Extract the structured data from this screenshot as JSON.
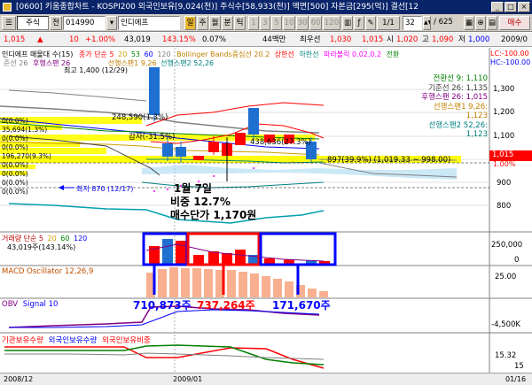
{
  "window": {
    "title": "[0600] 키움종합차트 - KOSPI200 외국인보유[9,024(천)] 주식수[58,933(천)] 액면[500] 자본금[295(억)] 결선[12"
  },
  "toolbar": {
    "market": "주식",
    "prev": "전",
    "code": "014990",
    "name": "인디에프",
    "period_day": "일",
    "period_week": "주",
    "period_month": "월",
    "period_min": "분",
    "period_tick": "틱",
    "nums": [
      "1",
      "3",
      "5",
      "10",
      "30",
      "60",
      "120"
    ],
    "ratio": "1/1",
    "count": "32",
    "total": "/ 625",
    "buy": "매수"
  },
  "quote": {
    "price": "1,015",
    "change": "▲",
    "change_val": "10",
    "change_pct": "+1.00%",
    "volume": "43,019",
    "vol_ratio": "143.15%",
    "turnover": "0.07%",
    "amount": "44백만",
    "low_label": "최우선",
    "ask": "1,030",
    "bid": "1,015",
    "open_label": "시",
    "open": "1,020",
    "high_label": "고",
    "high": "1,090",
    "low_lbl2": "저",
    "low": "1,000",
    "date": "2009/0"
  },
  "price_panel": {
    "header": [
      {
        "text": "인디에프 매물대 수(15)",
        "color": "#000000"
      },
      {
        "text": "종가 단순 5",
        "color": "#ff0000"
      },
      {
        "text": "20",
        "color": "#d0a000"
      },
      {
        "text": "53",
        "color": "#008000"
      },
      {
        "text": "60",
        "color": "#0000ff"
      },
      {
        "text": "120",
        "color": "#808080"
      },
      {
        "text": "Bollinger Bands중심선 20.2",
        "color": "#c08000"
      },
      {
        "text": "상한선",
        "color": "#ff0000"
      },
      {
        "text": "하한선",
        "color": "#008080"
      },
      {
        "text": "파라볼릭 0.02,0.2",
        "color": "#ff00ff"
      },
      {
        "text": "전환",
        "color": "#008000"
      }
    ],
    "header2": [
      {
        "text": "준선 26",
        "color": "#808080"
      },
      {
        "text": "후행스팬 26",
        "color": "#800080"
      },
      {
        "text": "선행스팬1 9,26",
        "color": "#c08000"
      },
      {
        "text": "선행스팬2 52,26",
        "color": "#008080"
      }
    ],
    "high_note": "최고 1,400 (12/29)",
    "low_note": "최저 870 (12/17)",
    "pct_note_left": "248,590(1.3%)",
    "pct_note_mid": "감자(-31.5%)",
    "pct_note_mid2": "438,636(27.3%)",
    "band_note": "897(39.9%) (1,019.33 ~ 998.00)",
    "left_pct_labels": [
      "0(0.0%)",
      "0(0.0%)",
      "0(0.0%)",
      "0(0.0%)",
      "0(0.0%)",
      "0(0.0%)",
      "0(0.0%)"
    ],
    "band_left_label": "196,270(9.3%)",
    "band_left_label2": "35,694(1.3%)",
    "legend": [
      {
        "label": "전환선 9",
        "value": "1,110",
        "color": "#008000"
      },
      {
        "label": "기준선 26",
        "value": "1,135",
        "color": "#404040"
      },
      {
        "label": "후행스팬 26",
        "value": "1,015",
        "color": "#800080"
      },
      {
        "label": "선행스팬1 9,26",
        "value": "1,123",
        "color": "#c08000"
      },
      {
        "label": "선행스팬2 52,26",
        "value": "1,123",
        "color": "#008080"
      }
    ],
    "lc": "LC:-100.00",
    "hc": "HC:-100.00",
    "axis": [
      "1,300",
      "1,200",
      "1,100",
      "1,000",
      "900",
      "800"
    ],
    "current": "1,015",
    "current_pct": "1.00%",
    "annotation": [
      "1월 7일",
      "비중 12.7%",
      "매수단가 1,170원"
    ]
  },
  "volume_panel": {
    "header": [
      {
        "text": "거래량 단순 5",
        "color": "#c00000"
      },
      {
        "text": "20",
        "color": "#d0a000"
      },
      {
        "text": "60",
        "color": "#008000"
      },
      {
        "text": "120",
        "color": "#0000ff"
      }
    ],
    "value": "43,019주(143.14%)",
    "axis": [
      "250,000",
      "0"
    ],
    "unit": "주"
  },
  "macd_panel": {
    "header": "MACD Oscillator 12,26,9",
    "axis": [
      "25.00"
    ],
    "annotations": [
      "710,873주",
      "737,264주",
      "171,670주"
    ]
  },
  "obv_panel": {
    "header": [
      {
        "text": "OBV",
        "color": "#800080"
      },
      {
        "text": "Signal 10",
        "color": "#0000ff"
      }
    ],
    "axis": [
      "-4,500K"
    ]
  },
  "inst_panel": {
    "header": [
      {
        "text": "기관보유수량",
        "color": "#ff0000"
      },
      {
        "text": "외국인보유수량",
        "color": "#0000ff"
      },
      {
        "text": "외국인보유비중",
        "color": "#ff0000"
      }
    ],
    "axis": [
      "15.32",
      "15"
    ]
  },
  "timeline": {
    "labels": [
      "2008/12",
      "2009/01",
      "01/16"
    ]
  },
  "colors": {
    "up": "#ff0000",
    "down": "#1e6fd0",
    "highlight_box": "#0000ff",
    "red_box": "#ff0000",
    "yellow_band": "#ffff00"
  }
}
